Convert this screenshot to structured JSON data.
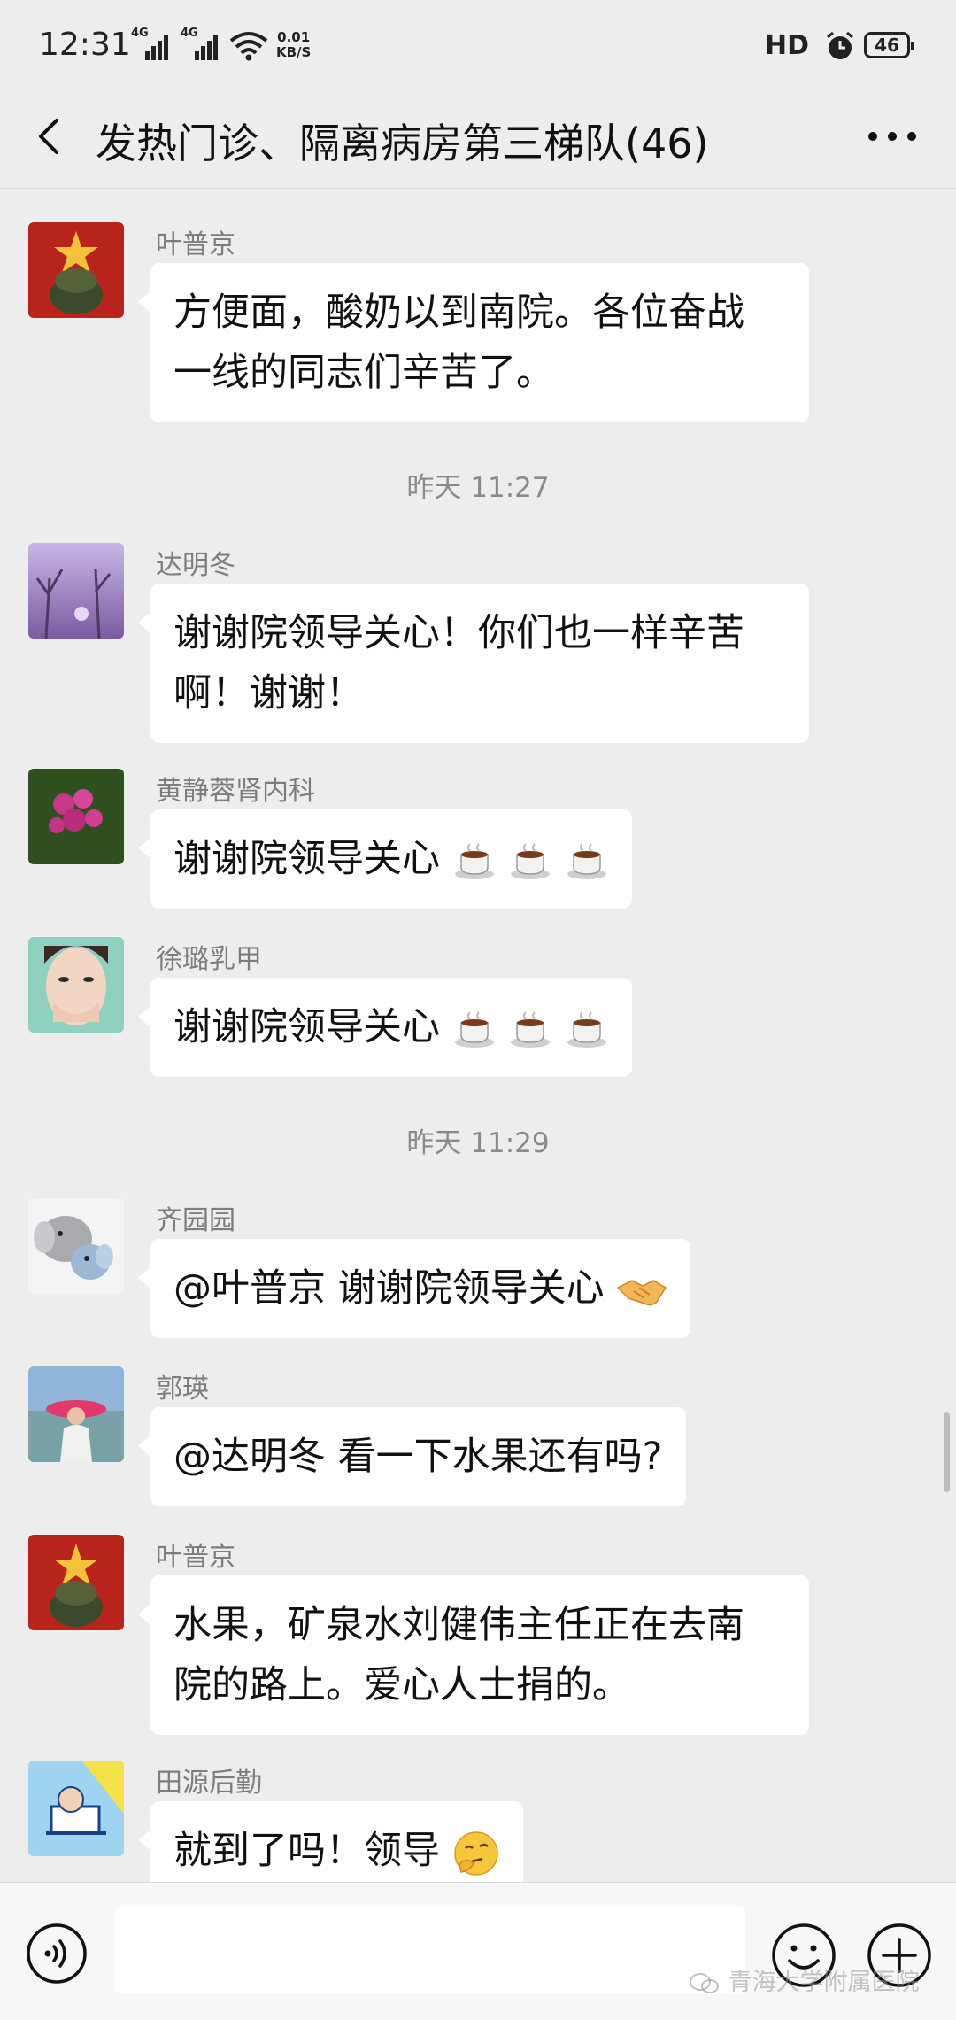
{
  "status_bar": {
    "time": "12:31",
    "signal1": "4G",
    "signal2": "4G",
    "speed_value": "0.01",
    "speed_unit": "KB/S",
    "hd": "HD",
    "battery": "46"
  },
  "header": {
    "title": "发热门诊、隔离病房第三梯队(46)"
  },
  "messages": [
    {
      "sender": "叶普京",
      "text_lines": [
        "方便面，酸奶以到南院。各位奋战",
        "一线的同志们辛苦了。"
      ]
    },
    {
      "timestamp": "昨天 11:27"
    },
    {
      "sender": "达明冬",
      "text_lines": [
        "谢谢院领导关心！你们也一样辛苦",
        "啊！谢谢！"
      ]
    },
    {
      "sender": "黄静蓉肾内科",
      "text": "谢谢院领导关心",
      "emoji": [
        "coffee-icon",
        "coffee-icon",
        "coffee-icon"
      ]
    },
    {
      "sender": "徐璐乳甲",
      "text": "谢谢院领导关心",
      "emoji": [
        "coffee-icon",
        "coffee-icon",
        "coffee-icon"
      ]
    },
    {
      "timestamp": "昨天 11:29"
    },
    {
      "sender": "齐园园",
      "text": "@叶普京  谢谢院领导关心",
      "emoji": [
        "handshake-icon"
      ]
    },
    {
      "sender": "郭瑛",
      "text": "@达明冬  看一下水果还有吗?"
    },
    {
      "sender": "叶普京",
      "text_lines": [
        "水果，矿泉水刘健伟主任正在去南",
        "院的路上。爱心人士捐的。"
      ]
    },
    {
      "sender": "田源后勤",
      "text": "就到了吗！领导",
      "emoji": [
        "thinking-face-icon"
      ]
    }
  ],
  "input_bar": {
    "placeholder": "",
    "watermark": "青海大学附属医院"
  }
}
